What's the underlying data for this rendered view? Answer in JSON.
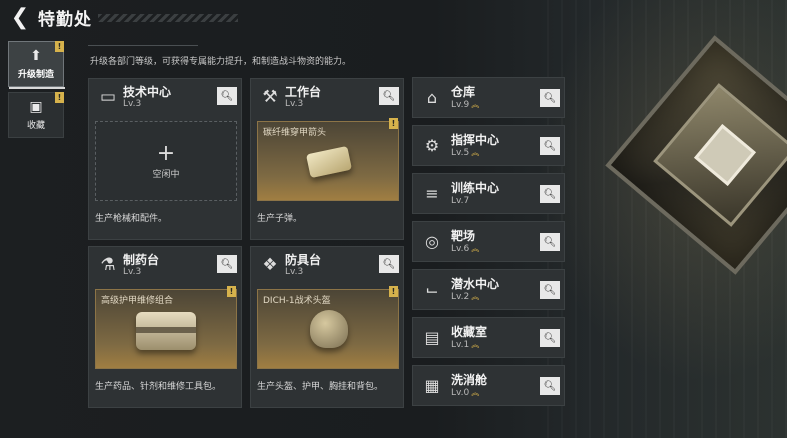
{
  "header": {
    "title": "特勤处",
    "back_icon": "back-arrow-icon"
  },
  "side_tabs": [
    {
      "label": "升级制造",
      "icon": "upgrade-icon",
      "active": true
    },
    {
      "label": "收藏",
      "icon": "collection-icon",
      "active": false
    }
  ],
  "intro": "升级各部门等级，可获得专属能力提升，和制造战斗物资的能力。",
  "cards": [
    {
      "name": "技术中心",
      "level": "Lv.3",
      "icon": "computer-icon",
      "status": "空闲中",
      "desc": "生产枪械和配件。"
    },
    {
      "name": "工作台",
      "level": "Lv.3",
      "icon": "tools-icon",
      "product": "碳纤维穿甲箭头",
      "desc": "生产子弹。"
    },
    {
      "name": "制药台",
      "level": "Lv.3",
      "icon": "pharmacy-icon",
      "product": "高级护甲维修组合",
      "desc": "生产药品、针剂和维修工具包。"
    },
    {
      "name": "防具台",
      "level": "Lv.3",
      "icon": "armor-icon",
      "product": "DICH-1战术头盔",
      "desc": "生产头盔、护甲、胸挂和背包。"
    }
  ],
  "flag_mark": "!",
  "list": [
    {
      "name": "仓库",
      "level": "Lv.9",
      "icon": "warehouse-icon",
      "upgradable": true
    },
    {
      "name": "指挥中心",
      "level": "Lv.5",
      "icon": "command-icon",
      "upgradable": true
    },
    {
      "name": "训练中心",
      "level": "Lv.7",
      "icon": "dumbbell-icon",
      "upgradable": false
    },
    {
      "name": "靶场",
      "level": "Lv.6",
      "icon": "target-icon",
      "upgradable": true
    },
    {
      "name": "潜水中心",
      "level": "Lv.2",
      "icon": "diving-mask-icon",
      "upgradable": true
    },
    {
      "name": "收藏室",
      "level": "Lv.1",
      "icon": "collection-room-icon",
      "upgradable": true
    },
    {
      "name": "洗消舱",
      "level": "Lv.0",
      "icon": "decon-icon",
      "upgradable": true
    }
  ],
  "upgrade_glyph": "︽",
  "search_glyph": "🔍︎",
  "plus_glyph": "+",
  "accent_color": "#d6b24c"
}
